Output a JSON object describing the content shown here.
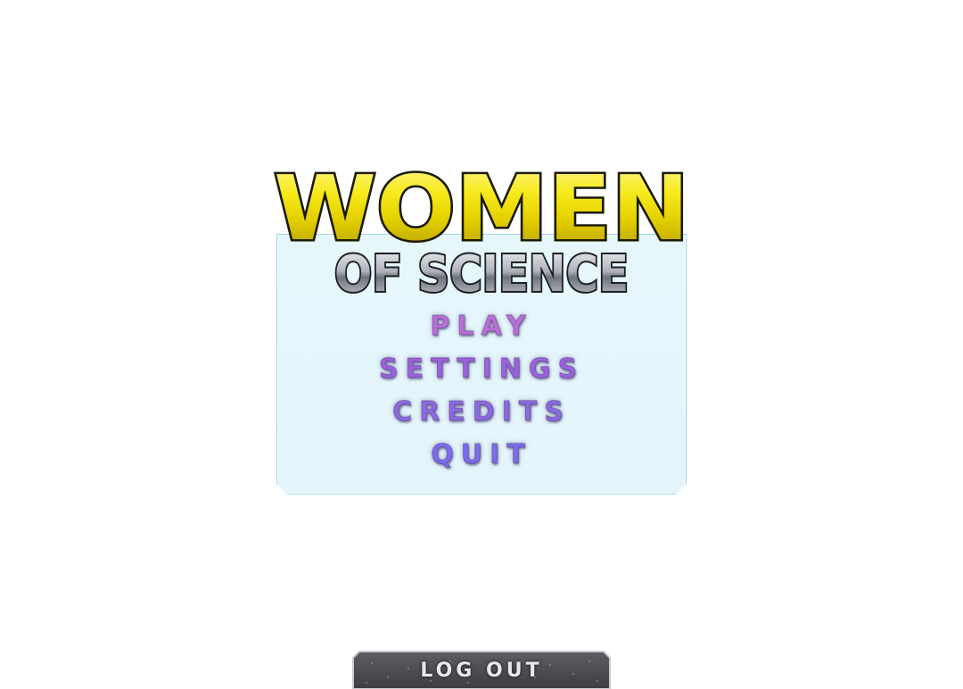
{
  "logo": {
    "line1": "WOMEN",
    "line2": "OF SCIENCE"
  },
  "menu": {
    "items": [
      {
        "label": "PLAY",
        "color": "#b86ed6"
      },
      {
        "label": "SETTINGS",
        "color": "#9a62dc"
      },
      {
        "label": "CREDITS",
        "color": "#8a6ae0"
      },
      {
        "label": "QUIT",
        "color": "#7a6cec"
      }
    ]
  },
  "logout": {
    "label": "LOG OUT"
  },
  "colors": {
    "panel": "#e5f6fb",
    "panel_border": "#9fd3e8",
    "logo_yellow": "#f2e30a",
    "logo_silver": "#b8bcc2",
    "logout_bg": "#4b4d52"
  }
}
